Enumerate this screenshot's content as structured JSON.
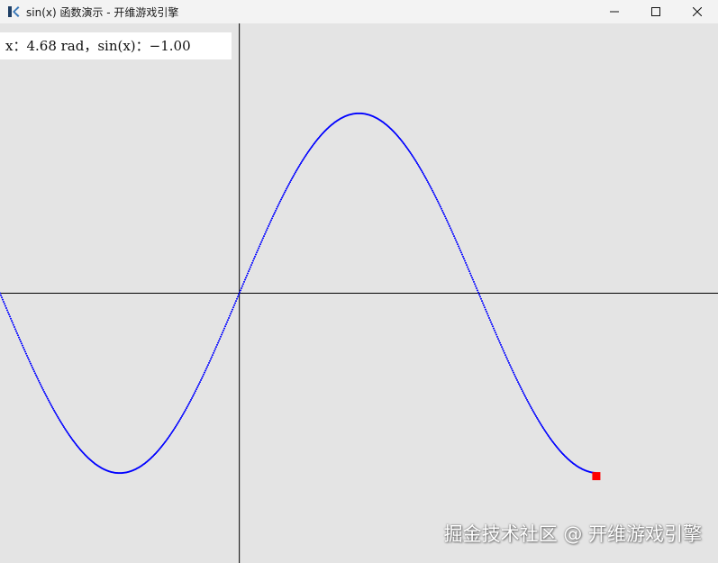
{
  "window": {
    "title": "sin(x) 函数演示 - 开维游戏引擎",
    "icon": "kaiwei-engine-logo",
    "controls": [
      "minimize-icon",
      "maximize-icon",
      "close-icon"
    ]
  },
  "readout": {
    "text": "x：4.68 rad，sin(x)：−1.00"
  },
  "watermark": {
    "text": "掘金技术社区 @ 开维游戏引擎"
  },
  "plot": {
    "background_color": "#e4e4e4",
    "axis_color": "#000000",
    "curve_color": "#0000ff",
    "marker_color": "#ff0000",
    "current_x": 4.68,
    "current_sin": -1.0,
    "x_range": [
      -3.1416,
      6.2832
    ],
    "y_range": [
      -1.5,
      1.5
    ],
    "drawn_x_span": [
      -3.1416,
      4.68
    ]
  }
}
